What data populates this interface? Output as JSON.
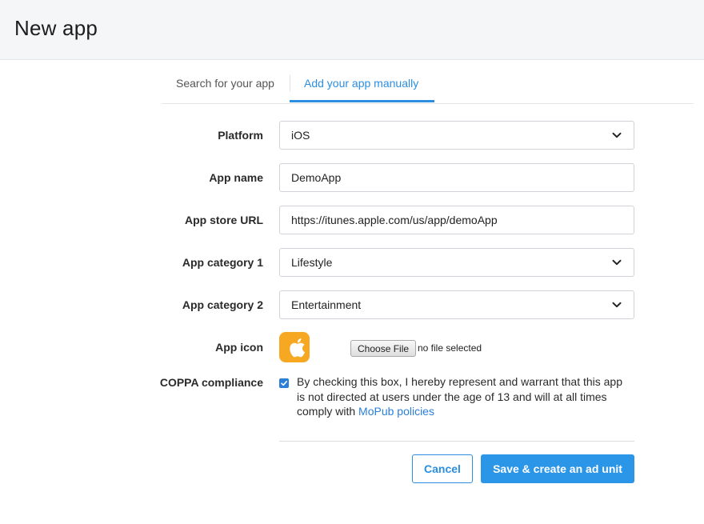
{
  "header": {
    "title": "New app"
  },
  "tabs": [
    {
      "label": "Search for your app",
      "active": false
    },
    {
      "label": "Add your app manually",
      "active": true
    }
  ],
  "form": {
    "platform": {
      "label": "Platform",
      "value": "iOS"
    },
    "app_name": {
      "label": "App name",
      "value": "DemoApp"
    },
    "app_store_url": {
      "label": "App store URL",
      "value": "https://itunes.apple.com/us/app/demoApp"
    },
    "category1": {
      "label": "App category 1",
      "value": "Lifestyle"
    },
    "category2": {
      "label": "App category 2",
      "value": "Entertainment"
    },
    "app_icon": {
      "label": "App icon",
      "button": "Choose File",
      "status": "no file selected",
      "icon": "apple-logo-icon"
    },
    "coppa": {
      "label": "COPPA compliance",
      "checked": true,
      "text": "By checking this box, I hereby represent and warrant that this app is not directed at users under the age of 13 and will at all times comply with",
      "link": "MoPub policies"
    }
  },
  "actions": {
    "cancel": "Cancel",
    "save": "Save & create an ad unit"
  },
  "colors": {
    "accent": "#2b8ee0",
    "icon_bg": "#f7a823",
    "header_bg": "#f4f6f8"
  }
}
